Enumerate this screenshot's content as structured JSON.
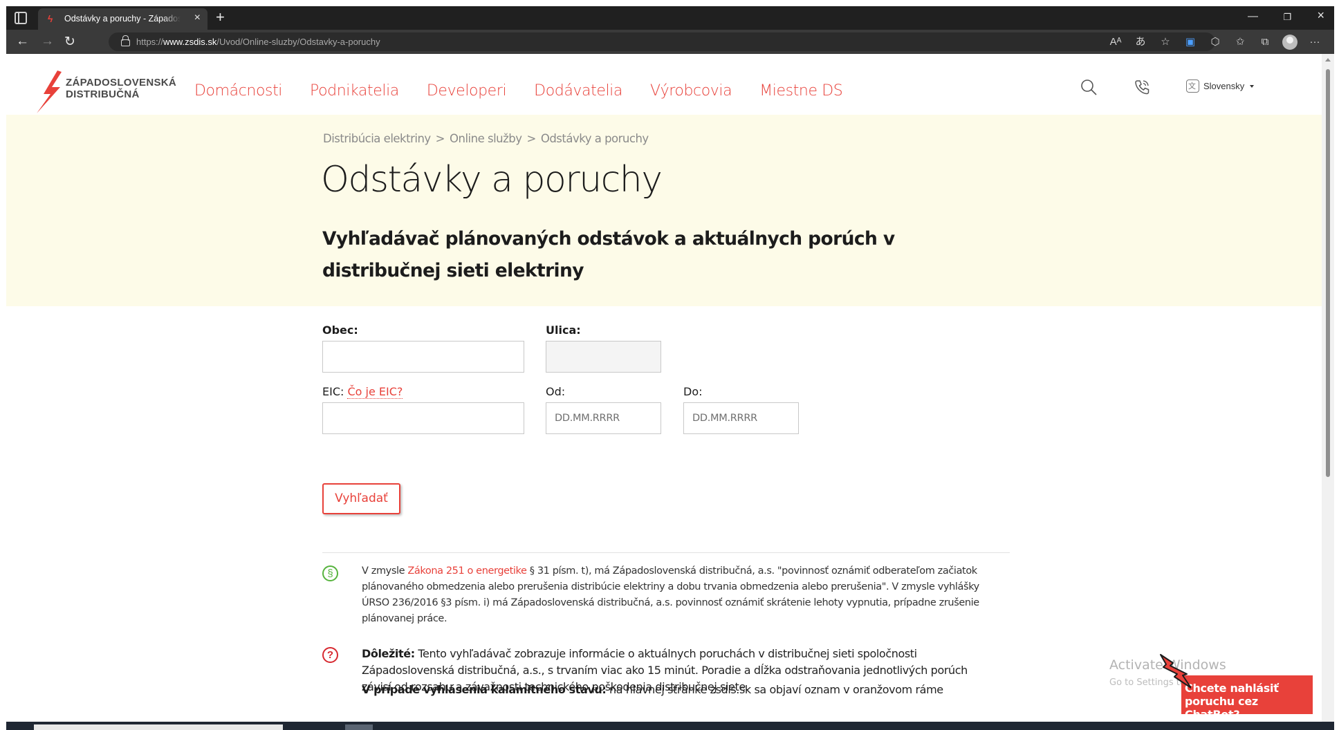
{
  "browser": {
    "tab_title": "Odstávky a poruchy - Západoslovenská distribučná",
    "url_prefix": "https://",
    "url_domain": "www.zsdis.sk",
    "url_path": "/Uvod/Online-sluzby/Odstavky-a-poruchy"
  },
  "site": {
    "logo_line1": "ZÁPADOSLOVENSKÁ",
    "logo_line2": "DISTRIBUČNÁ",
    "nav": [
      "Domácnosti",
      "Podnikatelia",
      "Developeri",
      "Dodávatelia",
      "Výrobcovia",
      "Miestne DS"
    ],
    "language": "Slovensky"
  },
  "breadcrumb": [
    "Distribúcia elektriny",
    "Online služby",
    "Odstávky a poruchy"
  ],
  "breadcrumb_sep": ">",
  "title": "Odstávky a poruchy",
  "subtitle": "Vyhľadávač plánovaných odstávok a aktuálnych porúch v distribučnej sieti elektriny",
  "form": {
    "obec_label": "Obec:",
    "ulica_label": "Ulica:",
    "eic_label": "EIC:",
    "eic_help": "Čo je EIC?",
    "od_label": "Od:",
    "do_label": "Do:",
    "date_placeholder": "DD.MM.RRRR",
    "search_button": "Vyhľadať"
  },
  "info": {
    "law_icon": "§",
    "law_prefix": "V zmysle ",
    "law_link": "Zákona 251 o energetike",
    "law_text": " § 31 písm. t), má Západoslovenská distribučná, a.s. \"povinnosť oznámiť odberateľom začiatok plánovaného obmedzenia alebo prerušenia distribúcie elektriny a dobu trvania obmedzenia alebo prerušenia\". V zmysle vyhlášky ÚRSO 236/2016 §3 písm. i) má Západoslovenská distribučná, a.s. povinnosť oznámiť skrátenie lehoty vypnutia, prípadne zrušenie plánovanej práce.",
    "important_icon": "?",
    "important_bold": "Dôležité:",
    "important_text": " Tento vyhľadávač zobrazuje informácie o aktuálnych poruchách v distribučnej sieti spoločnosti Západoslovenská distribučná, a.s., s trvaním viac ako 15 minút. Poradie a dĺžka odstraňovania jednotlivých porúch závisí od rozsahu a závažnosti technického poškodenia distribučnej siete.",
    "calamity_bold": "V prípade vyhlásenia kalamitného stavu:",
    "calamity_text": " na hlavnej stránke zsdis.sk sa objaví oznam v oranžovom ráme"
  },
  "overlay": {
    "watermark": "Activate Windows",
    "watermark_sub": "Go to Settings to activate Windows.",
    "chatbot": "Chcete nahlásiť poruchu cez ChatBot?"
  },
  "colors": {
    "accent": "#e8413a",
    "hero_bg": "#fdfbe8",
    "law_icon": "#56b33d",
    "important_icon": "#d7282f"
  }
}
